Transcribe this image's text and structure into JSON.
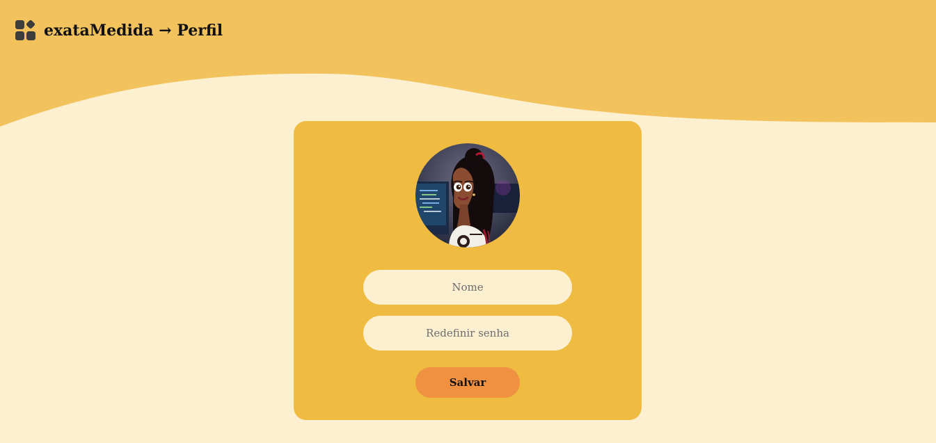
{
  "header": {
    "app_name": "exataMedida",
    "separator_icon": "arrow-right-icon",
    "page_name": "Perfil",
    "title": "exataMedida → Perfil",
    "logo_icon": "grid-apps-icon"
  },
  "profile": {
    "avatar_alt": "",
    "name_placeholder": "Nome",
    "name_value": "",
    "password_placeholder": "Redefinir senha",
    "password_value": "",
    "save_label": "Salvar"
  },
  "colors": {
    "header_wave": "#f2c35c",
    "page_background": "#fcf0d1",
    "card_background": "#efbb40",
    "input_background": "#fcf0d1",
    "save_button": "#ef9140",
    "text": "#111111"
  }
}
